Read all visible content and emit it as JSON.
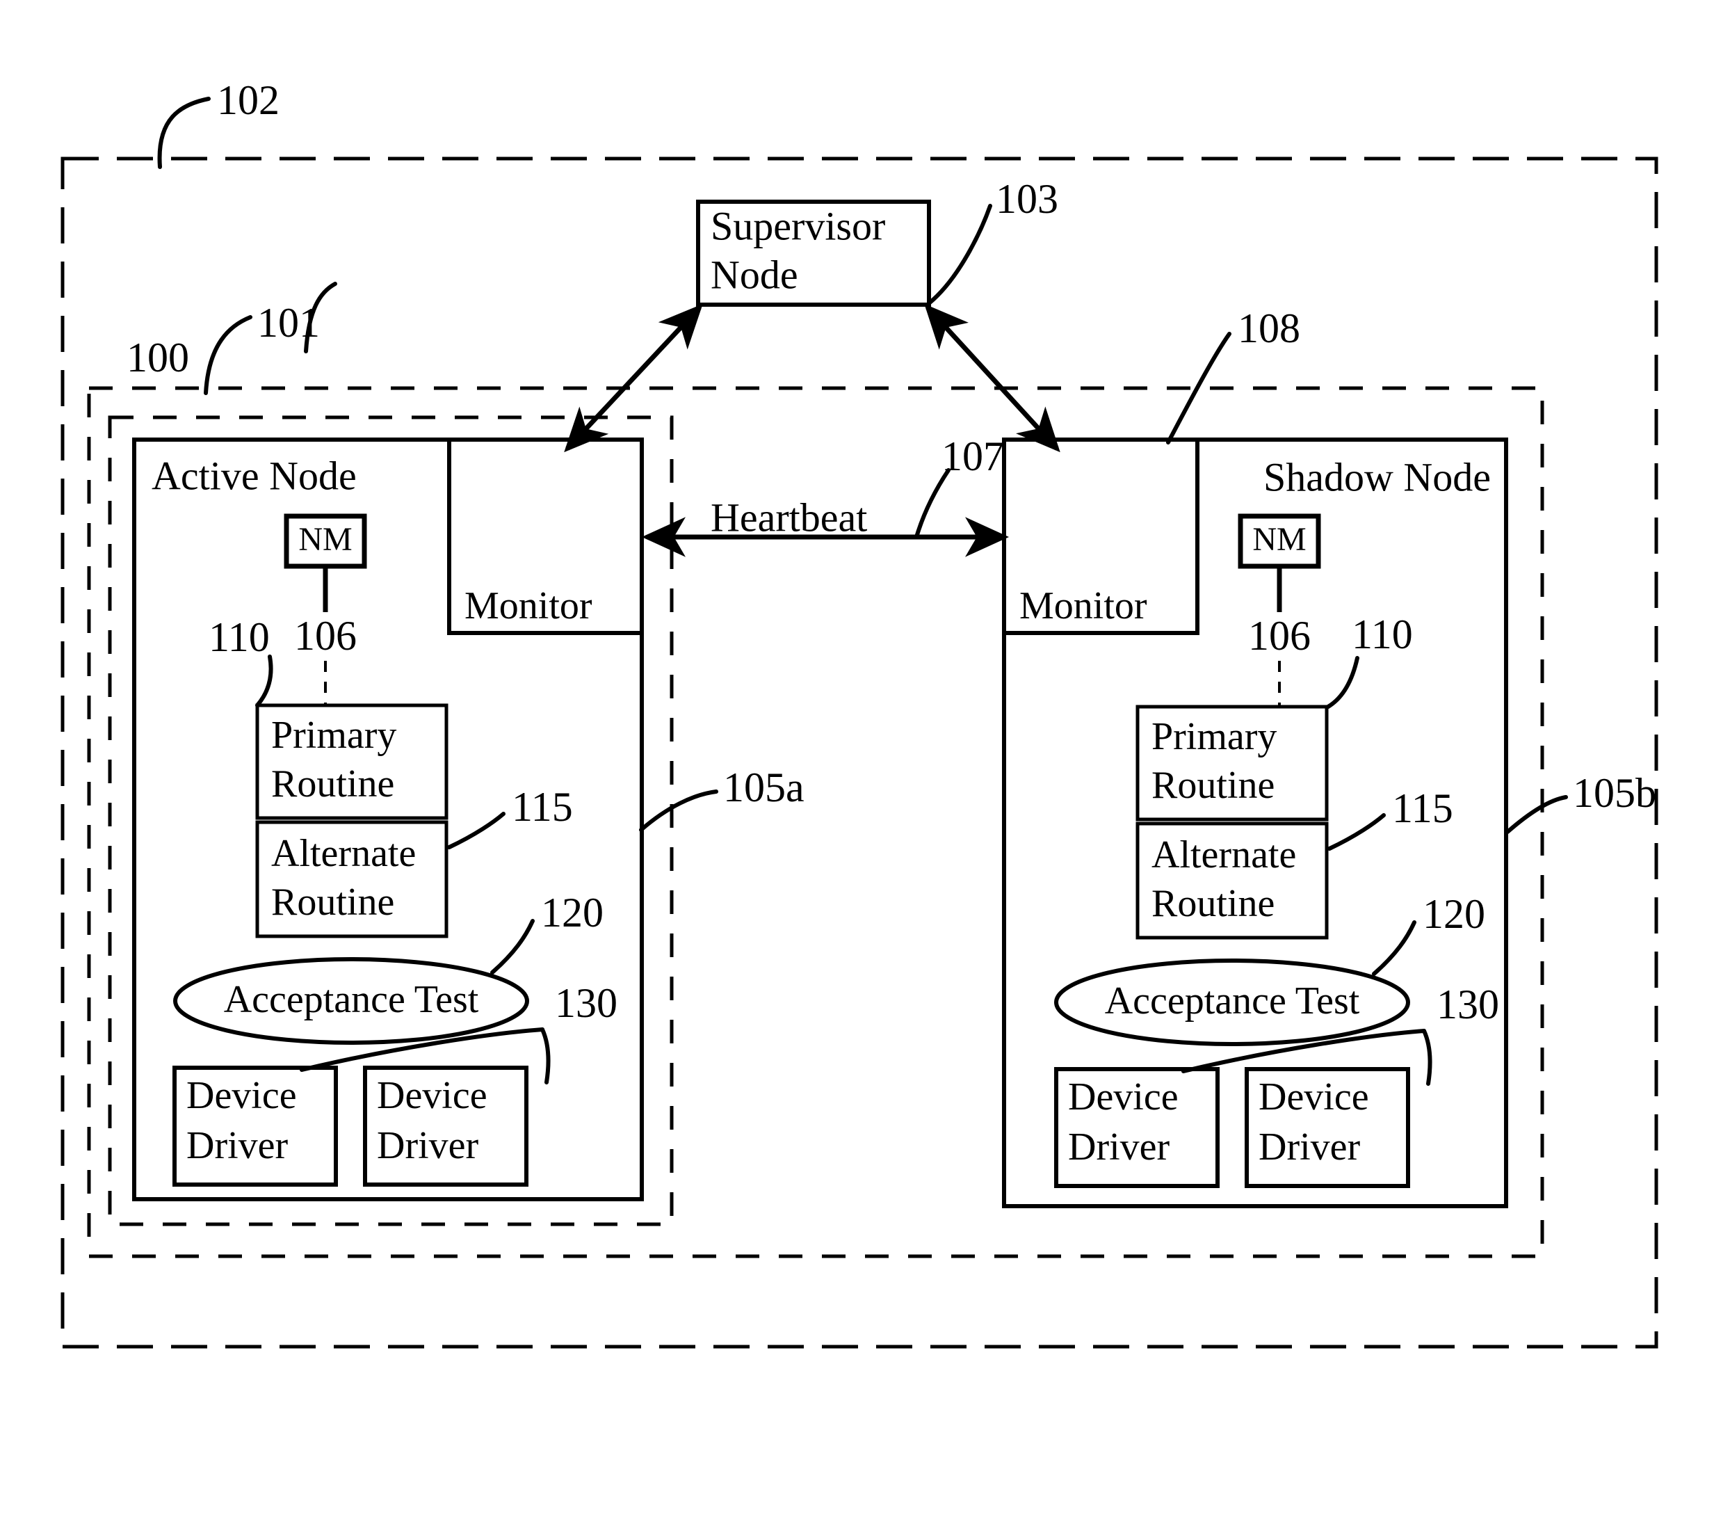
{
  "figure": {
    "supervisor": {
      "line1": "Supervisor",
      "line2": "Node",
      "ref": "103"
    },
    "outer_boundary_ref": "102",
    "system_ref": "100",
    "cluster_ref": "101",
    "heartbeat_label": "Heartbeat",
    "heartbeat_ref": "107",
    "active": {
      "title": "Active Node",
      "boundary_ref": "105a",
      "nm_label": "NM",
      "nm_ref": "106",
      "monitor_label": "Monitor",
      "primary_line1": "Primary",
      "primary_line2": "Routine",
      "primary_ref": "110",
      "alternate_line1": "Alternate",
      "alternate_line2": "Routine",
      "alternate_ref": "115",
      "acceptance_label": "Acceptance Test",
      "acceptance_ref": "120",
      "driver_ref": "130",
      "driver1_line1": "Device",
      "driver1_line2": "Driver",
      "driver2_line1": "Device",
      "driver2_line2": "Driver"
    },
    "shadow": {
      "title": "Shadow Node",
      "node_ref": "108",
      "boundary_ref": "105b",
      "nm_label": "NM",
      "nm_ref": "106",
      "monitor_label": "Monitor",
      "primary_line1": "Primary",
      "primary_line2": "Routine",
      "primary_ref": "110",
      "alternate_line1": "Alternate",
      "alternate_line2": "Routine",
      "alternate_ref": "115",
      "acceptance_label": "Acceptance Test",
      "acceptance_ref": "120",
      "driver_ref": "130",
      "driver1_line1": "Device",
      "driver1_line2": "Driver",
      "driver2_line1": "Device",
      "driver2_line2": "Driver"
    },
    "colors": {
      "ink": "#000000",
      "paper": "#ffffff"
    }
  }
}
